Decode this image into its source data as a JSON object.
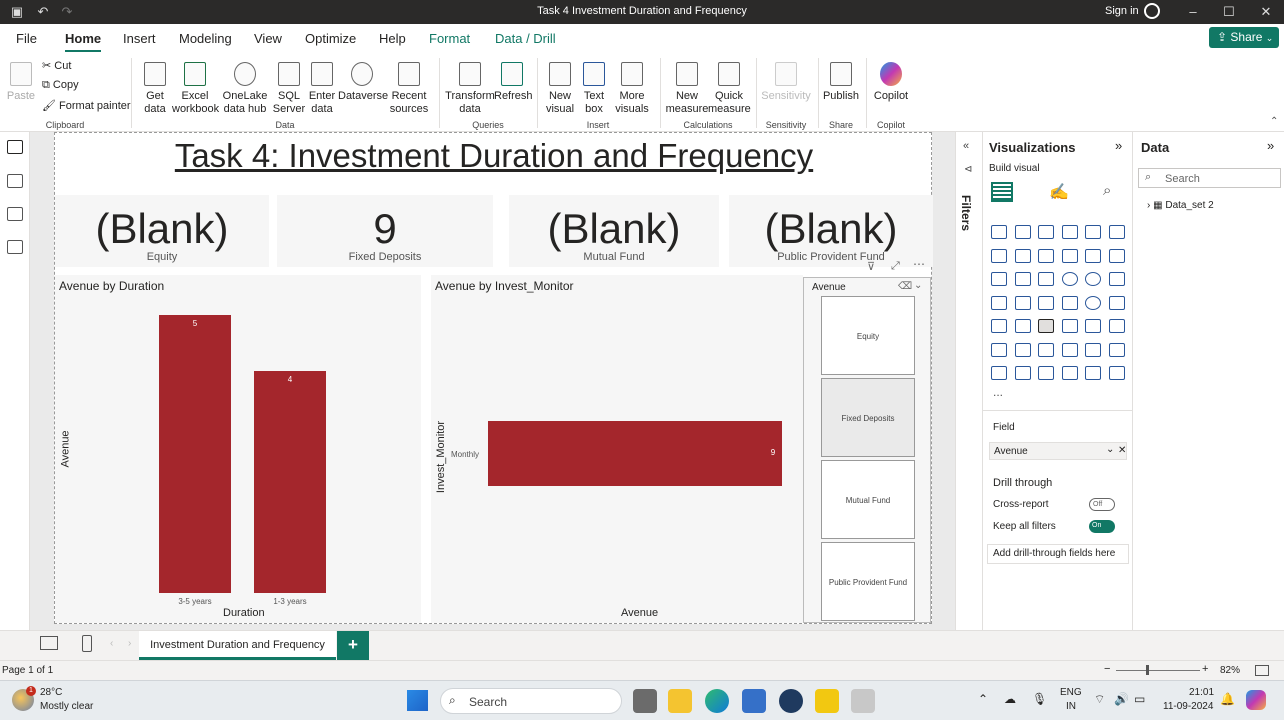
{
  "titlebar": {
    "title": "Task 4 Investment Duration and Frequency",
    "signin": "Sign in"
  },
  "menu": {
    "items": [
      "File",
      "Home",
      "Insert",
      "Modeling",
      "View",
      "Optimize",
      "Help",
      "Format",
      "Data / Drill"
    ],
    "share": "Share"
  },
  "ribbon": {
    "clipboard": {
      "paste": "Paste",
      "cut": "Cut",
      "copy": "Copy",
      "format_painter": "Format painter",
      "group": "Clipboard"
    },
    "data": {
      "get_data": "Get data",
      "excel": "Excel workbook",
      "onelake": "OneLake data hub",
      "sql": "SQL Server",
      "enter": "Enter data",
      "dataverse": "Dataverse",
      "recent": "Recent sources",
      "group": "Data"
    },
    "queries": {
      "transform": "Transform data",
      "refresh": "Refresh",
      "group": "Queries"
    },
    "insert": {
      "new_visual": "New visual",
      "text_box": "Text box",
      "more_visuals": "More visuals",
      "group": "Insert"
    },
    "calculations": {
      "new_measure": "New measure",
      "quick_measure": "Quick measure",
      "group": "Calculations"
    },
    "sensitivity": {
      "label": "Sensitivity",
      "group": "Sensitivity"
    },
    "share": {
      "publish": "Publish",
      "group": "Share"
    },
    "copilot": {
      "label": "Copilot",
      "group": "Copilot"
    }
  },
  "report": {
    "title": "Task 4: Investment Duration and Frequency",
    "cards": [
      {
        "value": "(Blank)",
        "label": "Equity"
      },
      {
        "value": "9",
        "label": "Fixed Deposits"
      },
      {
        "value": "(Blank)",
        "label": "Mutual Fund"
      },
      {
        "value": "(Blank)",
        "label": "Public Provident Fund"
      }
    ],
    "chart1": {
      "title": "Avenue by Duration",
      "xlabel": "Duration",
      "ylabel": "Avenue"
    },
    "chart2": {
      "title": "Avenue by Invest_Monitor",
      "xlabel": "Avenue",
      "ylabel": "Invest_Monitor"
    },
    "slicer": {
      "title": "Avenue",
      "items": [
        "Equity",
        "Fixed Deposits",
        "Mutual Fund",
        "Public Provident Fund"
      ]
    }
  },
  "chart_data": [
    {
      "type": "bar",
      "title": "Avenue by Duration",
      "categories": [
        "3-5 years",
        "1-3 years"
      ],
      "values": [
        5,
        4
      ],
      "xlabel": "Duration",
      "ylabel": "Avenue",
      "ylim": [
        0,
        5
      ],
      "color": "#a4262c"
    },
    {
      "type": "bar",
      "orientation": "horizontal",
      "title": "Avenue by Invest_Monitor",
      "categories": [
        "Monthly"
      ],
      "values": [
        9
      ],
      "xlabel": "Avenue",
      "ylabel": "Invest_Monitor",
      "xlim": [
        0,
        9
      ],
      "color": "#a4262c"
    }
  ],
  "filters": {
    "label": "Filters"
  },
  "visualizations": {
    "title": "Visualizations",
    "build_visual": "Build visual",
    "field_label": "Field",
    "field_value": "Avenue",
    "drill_through": "Drill through",
    "cross_report": "Cross-report",
    "cross_report_state": "Off",
    "keep_all_filters": "Keep all filters",
    "keep_state": "On",
    "add_drill": "Add drill-through fields here",
    "more": "..."
  },
  "data_pane": {
    "title": "Data",
    "search_placeholder": "Search",
    "tables": [
      "Data_set 2"
    ]
  },
  "tabs": {
    "active": "Investment Duration and Frequency",
    "add": "+"
  },
  "status": {
    "page": "Page 1 of 1",
    "zoom": "82%"
  },
  "taskbar": {
    "temp": "28°C",
    "weather": "Mostly clear",
    "search": "Search",
    "lang1": "ENG",
    "lang2": "IN",
    "time": "21:01",
    "date": "11-09-2024",
    "badge": "1"
  },
  "colors": {
    "accent": "#117865",
    "bar": "#a4262c"
  }
}
